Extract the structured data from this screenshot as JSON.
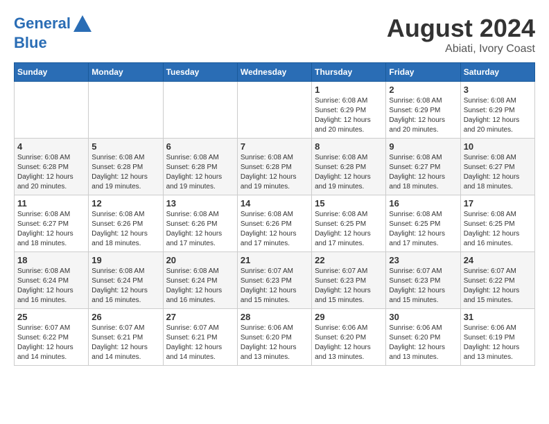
{
  "logo": {
    "line1": "General",
    "line2": "Blue"
  },
  "title": "August 2024",
  "subtitle": "Abiati, Ivory Coast",
  "days_of_week": [
    "Sunday",
    "Monday",
    "Tuesday",
    "Wednesday",
    "Thursday",
    "Friday",
    "Saturday"
  ],
  "weeks": [
    [
      {
        "day": "",
        "info": ""
      },
      {
        "day": "",
        "info": ""
      },
      {
        "day": "",
        "info": ""
      },
      {
        "day": "",
        "info": ""
      },
      {
        "day": "1",
        "info": "Sunrise: 6:08 AM\nSunset: 6:29 PM\nDaylight: 12 hours and 20 minutes."
      },
      {
        "day": "2",
        "info": "Sunrise: 6:08 AM\nSunset: 6:29 PM\nDaylight: 12 hours and 20 minutes."
      },
      {
        "day": "3",
        "info": "Sunrise: 6:08 AM\nSunset: 6:29 PM\nDaylight: 12 hours and 20 minutes."
      }
    ],
    [
      {
        "day": "4",
        "info": "Sunrise: 6:08 AM\nSunset: 6:28 PM\nDaylight: 12 hours and 20 minutes."
      },
      {
        "day": "5",
        "info": "Sunrise: 6:08 AM\nSunset: 6:28 PM\nDaylight: 12 hours and 19 minutes."
      },
      {
        "day": "6",
        "info": "Sunrise: 6:08 AM\nSunset: 6:28 PM\nDaylight: 12 hours and 19 minutes."
      },
      {
        "day": "7",
        "info": "Sunrise: 6:08 AM\nSunset: 6:28 PM\nDaylight: 12 hours and 19 minutes."
      },
      {
        "day": "8",
        "info": "Sunrise: 6:08 AM\nSunset: 6:28 PM\nDaylight: 12 hours and 19 minutes."
      },
      {
        "day": "9",
        "info": "Sunrise: 6:08 AM\nSunset: 6:27 PM\nDaylight: 12 hours and 18 minutes."
      },
      {
        "day": "10",
        "info": "Sunrise: 6:08 AM\nSunset: 6:27 PM\nDaylight: 12 hours and 18 minutes."
      }
    ],
    [
      {
        "day": "11",
        "info": "Sunrise: 6:08 AM\nSunset: 6:27 PM\nDaylight: 12 hours and 18 minutes."
      },
      {
        "day": "12",
        "info": "Sunrise: 6:08 AM\nSunset: 6:26 PM\nDaylight: 12 hours and 18 minutes."
      },
      {
        "day": "13",
        "info": "Sunrise: 6:08 AM\nSunset: 6:26 PM\nDaylight: 12 hours and 17 minutes."
      },
      {
        "day": "14",
        "info": "Sunrise: 6:08 AM\nSunset: 6:26 PM\nDaylight: 12 hours and 17 minutes."
      },
      {
        "day": "15",
        "info": "Sunrise: 6:08 AM\nSunset: 6:25 PM\nDaylight: 12 hours and 17 minutes."
      },
      {
        "day": "16",
        "info": "Sunrise: 6:08 AM\nSunset: 6:25 PM\nDaylight: 12 hours and 17 minutes."
      },
      {
        "day": "17",
        "info": "Sunrise: 6:08 AM\nSunset: 6:25 PM\nDaylight: 12 hours and 16 minutes."
      }
    ],
    [
      {
        "day": "18",
        "info": "Sunrise: 6:08 AM\nSunset: 6:24 PM\nDaylight: 12 hours and 16 minutes."
      },
      {
        "day": "19",
        "info": "Sunrise: 6:08 AM\nSunset: 6:24 PM\nDaylight: 12 hours and 16 minutes."
      },
      {
        "day": "20",
        "info": "Sunrise: 6:08 AM\nSunset: 6:24 PM\nDaylight: 12 hours and 16 minutes."
      },
      {
        "day": "21",
        "info": "Sunrise: 6:07 AM\nSunset: 6:23 PM\nDaylight: 12 hours and 15 minutes."
      },
      {
        "day": "22",
        "info": "Sunrise: 6:07 AM\nSunset: 6:23 PM\nDaylight: 12 hours and 15 minutes."
      },
      {
        "day": "23",
        "info": "Sunrise: 6:07 AM\nSunset: 6:23 PM\nDaylight: 12 hours and 15 minutes."
      },
      {
        "day": "24",
        "info": "Sunrise: 6:07 AM\nSunset: 6:22 PM\nDaylight: 12 hours and 15 minutes."
      }
    ],
    [
      {
        "day": "25",
        "info": "Sunrise: 6:07 AM\nSunset: 6:22 PM\nDaylight: 12 hours and 14 minutes."
      },
      {
        "day": "26",
        "info": "Sunrise: 6:07 AM\nSunset: 6:21 PM\nDaylight: 12 hours and 14 minutes."
      },
      {
        "day": "27",
        "info": "Sunrise: 6:07 AM\nSunset: 6:21 PM\nDaylight: 12 hours and 14 minutes."
      },
      {
        "day": "28",
        "info": "Sunrise: 6:06 AM\nSunset: 6:20 PM\nDaylight: 12 hours and 13 minutes."
      },
      {
        "day": "29",
        "info": "Sunrise: 6:06 AM\nSunset: 6:20 PM\nDaylight: 12 hours and 13 minutes."
      },
      {
        "day": "30",
        "info": "Sunrise: 6:06 AM\nSunset: 6:20 PM\nDaylight: 12 hours and 13 minutes."
      },
      {
        "day": "31",
        "info": "Sunrise: 6:06 AM\nSunset: 6:19 PM\nDaylight: 12 hours and 13 minutes."
      }
    ]
  ]
}
